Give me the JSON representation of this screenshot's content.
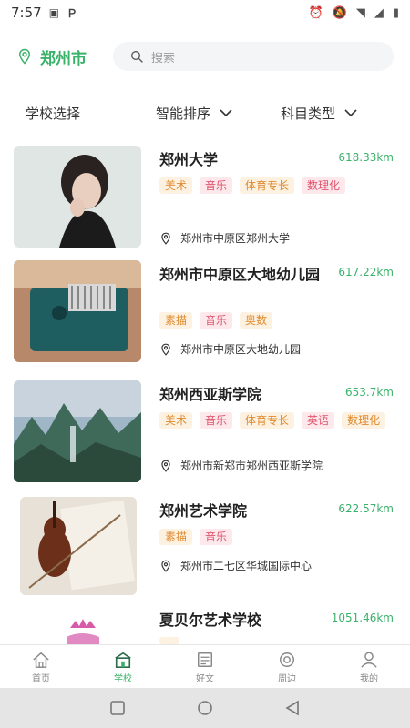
{
  "status_bar": {
    "time": "7:57",
    "battery_icon": "battery-icon"
  },
  "header": {
    "city": "郑州市",
    "search_placeholder": "搜索"
  },
  "filters": {
    "school_select": "学校选择",
    "smart_sort": "智能排序",
    "subject_type": "科目类型"
  },
  "schools": [
    {
      "name": "郑州大学",
      "distance": "618.33km",
      "tags": [
        "美术",
        "音乐",
        "体育专长",
        "数理化"
      ],
      "address": "郑州市中原区郑州大学"
    },
    {
      "name": "郑州市中原区大地幼儿园",
      "distance": "617.22km",
      "tags": [
        "素描",
        "音乐",
        "奥数"
      ],
      "address": "郑州市中原区大地幼儿园"
    },
    {
      "name": "郑州西亚斯学院",
      "distance": "653.7km",
      "tags": [
        "美术",
        "音乐",
        "体育专长",
        "英语",
        "数理化"
      ],
      "address": "郑州市新郑市郑州西亚斯学院"
    },
    {
      "name": "郑州艺术学院",
      "distance": "622.57km",
      "tags": [
        "素描",
        "音乐"
      ],
      "address": "郑州市二七区华城国际中心"
    },
    {
      "name": "夏贝尔艺术学校",
      "distance": "1051.46km",
      "tags": [],
      "address": ""
    }
  ],
  "tabs": [
    {
      "label": "首页",
      "icon": "home-icon"
    },
    {
      "label": "学校",
      "icon": "school-icon",
      "active": true
    },
    {
      "label": "好文",
      "icon": "article-icon"
    },
    {
      "label": "周边",
      "icon": "nearby-icon"
    },
    {
      "label": "我的",
      "icon": "user-icon"
    }
  ],
  "colors": {
    "accent": "#3ab26a",
    "tag_orange": "#e08a2c",
    "tag_pink": "#e0566f"
  }
}
